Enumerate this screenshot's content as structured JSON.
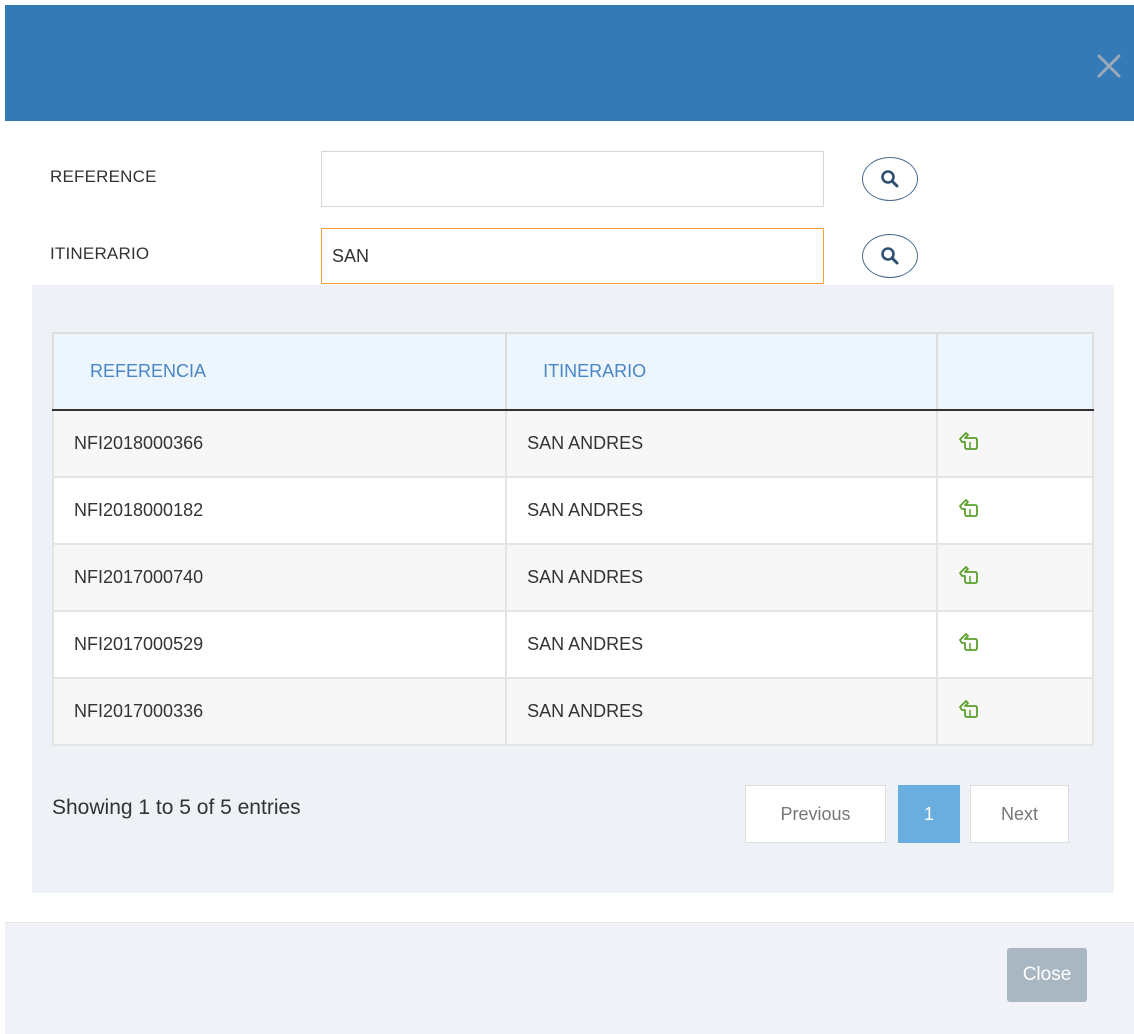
{
  "form": {
    "reference_label": "REFERENCE",
    "reference_value": "",
    "itinerario_label": "ITINERARIO",
    "itinerario_value": "SAN"
  },
  "table": {
    "columns": [
      "REFERENCIA",
      "ITINERARIO",
      ""
    ],
    "rows": [
      {
        "referencia": "NFI2018000366",
        "itinerario": "SAN ANDRES"
      },
      {
        "referencia": "NFI2018000182",
        "itinerario": "SAN ANDRES"
      },
      {
        "referencia": "NFI2017000740",
        "itinerario": "SAN ANDRES"
      },
      {
        "referencia": "NFI2017000529",
        "itinerario": "SAN ANDRES"
      },
      {
        "referencia": "NFI2017000336",
        "itinerario": "SAN ANDRES"
      }
    ],
    "row_action_icon": "select-hand-icon"
  },
  "pagination": {
    "info": "Showing 1 to 5 of 5 entries",
    "previous_label": "Previous",
    "current_page": "1",
    "next_label": "Next"
  },
  "footer": {
    "close_label": "Close"
  },
  "colors": {
    "header": "#337ab7",
    "table_header_text": "#4a86c5",
    "active_page": "#6aaee0",
    "focus_border": "#f0a13a",
    "select_icon": "#5aa02c",
    "close_button": "#a9b7c3"
  }
}
